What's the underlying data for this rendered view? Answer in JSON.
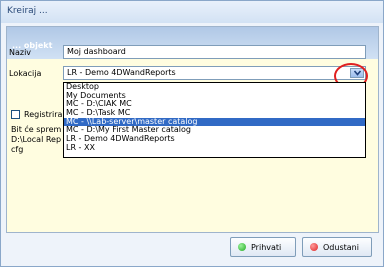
{
  "window": {
    "title": "Kreiraj ..."
  },
  "header": {
    "title": "... objekt"
  },
  "form": {
    "name_label": "Naziv",
    "name_value": "Moj dashboard",
    "location_label": "Lokacija",
    "location_value": "LR - Demo 4DWandReports",
    "location_options": [
      "Desktop",
      "My Documents",
      "MC - D:\\CIAK MC",
      "MC - D:\\Task MC",
      "MC - \\\\Lab-server\\master catalog",
      "MC - D:\\My First Master catalog",
      "LR - Demo 4DWandReports",
      "LR - XX"
    ],
    "highlighted_option_index": 4,
    "checkbox_label": "Registrira",
    "info_lines": [
      "Bit će sprem",
      "D:\\Local Rep",
      "cfg"
    ]
  },
  "buttons": {
    "accept_label": "Prihvati",
    "cancel_label": "Odustani"
  },
  "colors": {
    "accept_dot": "#22aa22",
    "cancel_dot": "#dd2222",
    "annotation_circle": "#e02020"
  },
  "icons": {
    "dropdown": "chevron-down-icon"
  }
}
